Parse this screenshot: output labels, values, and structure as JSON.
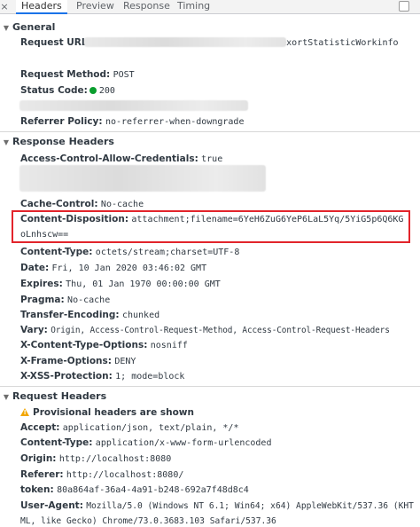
{
  "tabs": [
    {
      "label": "Headers",
      "active": true
    },
    {
      "label": "Preview",
      "active": false
    },
    {
      "label": "Response",
      "active": false
    },
    {
      "label": "Timing",
      "active": false
    }
  ],
  "icons": {
    "close": "close-icon",
    "collapse": "triangle-down-icon",
    "status": "green-dot-icon",
    "warning": "warning-icon"
  },
  "colors": {
    "accent": "#1a73e8",
    "highlight": "#e2242b",
    "status_ok": "#0a9e2e",
    "warning": "#f2a600"
  },
  "general": {
    "title": "General",
    "request_url": {
      "key": "Request URL:",
      "value": "/exortStatisticWorkinfo"
    },
    "request_method": {
      "key": "Request Method:",
      "value": "POST"
    },
    "status_code": {
      "key": "Status Code:",
      "value": "200"
    },
    "referrer_policy": {
      "key": "Referrer Policy:",
      "value": "no-referrer-when-downgrade"
    }
  },
  "response_headers": {
    "title": "Response Headers",
    "acac": {
      "key": "Access-Control-Allow-Credentials:",
      "value": "true"
    },
    "cache_control": {
      "key": "Cache-Control:",
      "value": "No-cache"
    },
    "content_disposition": {
      "key": "Content-Disposition:",
      "value": "attachment;filename=6YeH6ZuG6YeP6LaL5Yq/5YiG5p6Q6KGoLnhscw=="
    },
    "content_type": {
      "key": "Content-Type:",
      "value": "octets/stream;charset=UTF-8"
    },
    "date": {
      "key": "Date:",
      "value": "Fri, 10 Jan 2020 03:46:02 GMT"
    },
    "expires": {
      "key": "Expires:",
      "value": "Thu, 01 Jan 1970 00:00:00 GMT"
    },
    "pragma": {
      "key": "Pragma:",
      "value": "No-cache"
    },
    "transfer_encoding": {
      "key": "Transfer-Encoding:",
      "value": "chunked"
    },
    "vary": {
      "key": "Vary:",
      "value": "Origin, Access-Control-Request-Method, Access-Control-Request-Headers"
    },
    "xcto": {
      "key": "X-Content-Type-Options:",
      "value": "nosniff"
    },
    "xfo": {
      "key": "X-Frame-Options:",
      "value": "DENY"
    },
    "xxss": {
      "key": "X-XSS-Protection:",
      "value": "1; mode=block"
    }
  },
  "request_headers": {
    "title": "Request Headers",
    "provisional": "Provisional headers are shown",
    "accept": {
      "key": "Accept:",
      "value": "application/json, text/plain, */*"
    },
    "content_type": {
      "key": "Content-Type:",
      "value": "application/x-www-form-urlencoded"
    },
    "origin": {
      "key": "Origin:",
      "value": "http://localhost:8080"
    },
    "referer": {
      "key": "Referer:",
      "value": "http://localhost:8080/"
    },
    "token": {
      "key": "token:",
      "value": "80a864af-36a4-4a91-b248-692a7f48d8c4"
    },
    "user_agent": {
      "key": "User-Agent:",
      "value": "Mozilla/5.0 (Windows NT 6.1; Win64; x64) AppleWebKit/537.36 (KHTML, like Gecko) Chrome/73.0.3683.103 Safari/537.36"
    }
  }
}
